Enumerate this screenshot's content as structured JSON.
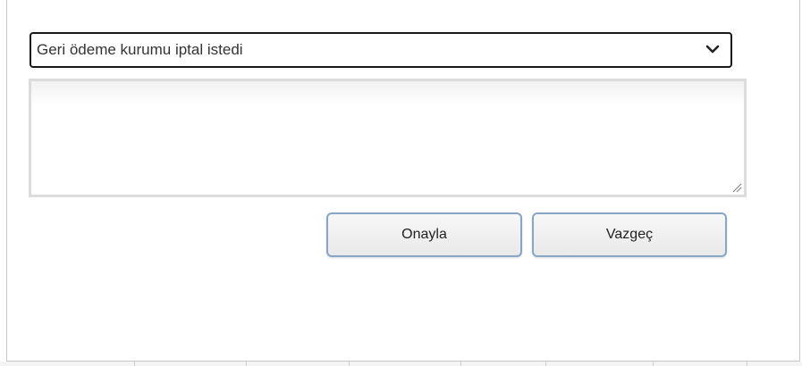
{
  "reason_select": {
    "selected": "Geri ödeme kurumu iptal istedi",
    "icon": "chevron-down-icon"
  },
  "note_textarea": {
    "value": "",
    "placeholder": ""
  },
  "actions": {
    "confirm_label": "Onayla",
    "cancel_label": "Vazgeç"
  }
}
